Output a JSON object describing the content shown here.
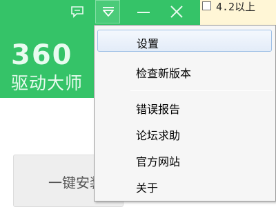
{
  "app": {
    "logo_number": "360",
    "logo_text": "驱动大师",
    "onekey_label": "一键安装"
  },
  "titlebar": {
    "buttons": [
      {
        "name": "feedback",
        "icon": "chat-bubble-icon"
      },
      {
        "name": "menu",
        "icon": "menu-dropdown-icon"
      },
      {
        "name": "minimize",
        "icon": "minimize-icon"
      },
      {
        "name": "close",
        "icon": "close-icon"
      }
    ]
  },
  "filter": {
    "label": "4.2以上",
    "checked": false
  },
  "menu": {
    "items": [
      {
        "label": "设置",
        "active": true
      },
      {
        "label": "检查新版本"
      },
      {
        "label": "错误报告"
      },
      {
        "label": "论坛求助"
      },
      {
        "label": "官方网站"
      },
      {
        "label": "关于"
      }
    ]
  },
  "colors": {
    "brand_green": "#35c368",
    "menu_highlight": "#e3ecf8",
    "strip_yellow": "#fff6d6"
  }
}
